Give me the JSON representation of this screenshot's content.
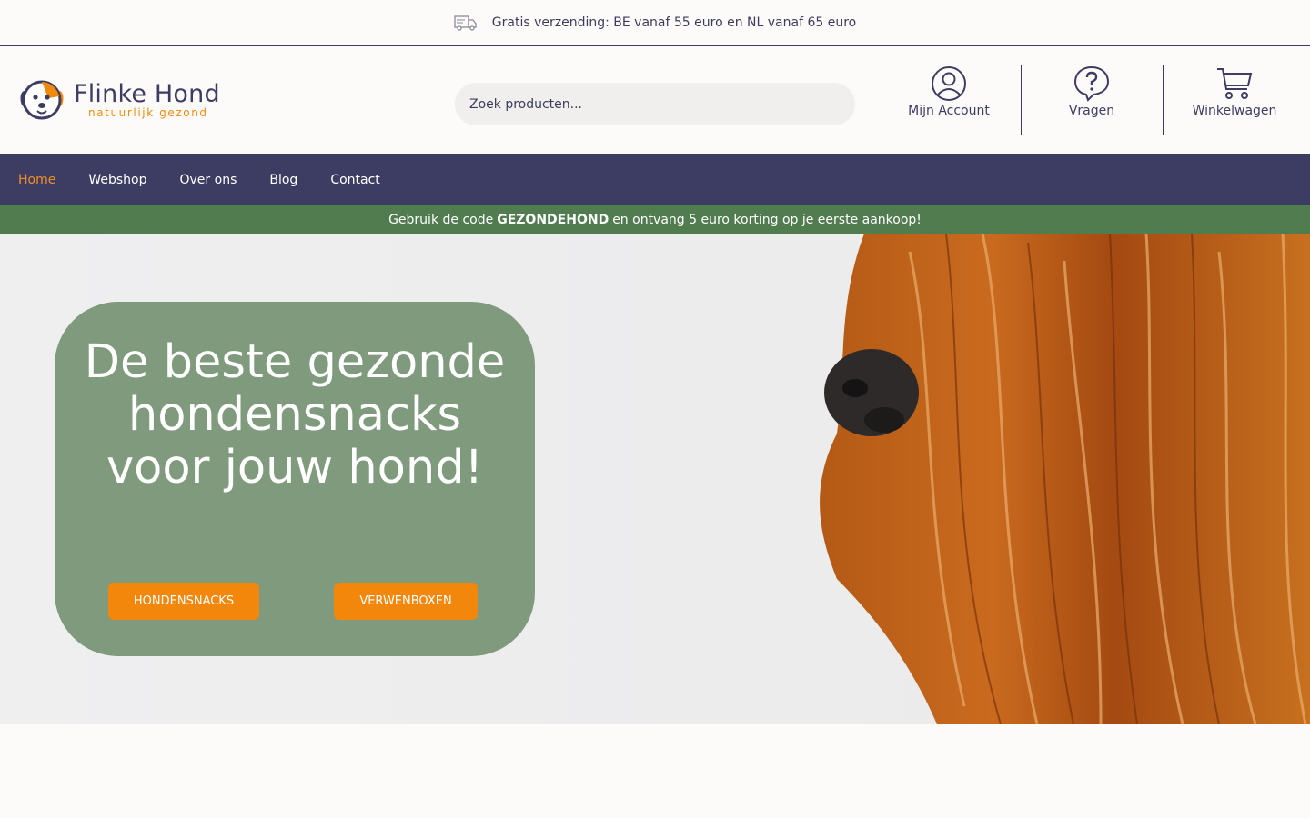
{
  "topbar": {
    "shipping_text": "Gratis verzending: BE vanaf 55 euro en NL vanaf 65 euro",
    "icon": "truck-icon"
  },
  "header": {
    "logo": {
      "name": "Flinke Hond",
      "tagline": "natuurlijk gezond"
    },
    "search": {
      "placeholder": "Zoek producten..."
    },
    "account_label": "Mijn Account",
    "questions_label": "Vragen",
    "cart_label": "Winkelwagen"
  },
  "nav": {
    "items": [
      {
        "label": "Home",
        "active": true
      },
      {
        "label": "Webshop"
      },
      {
        "label": "Over ons"
      },
      {
        "label": "Blog"
      },
      {
        "label": "Contact"
      }
    ]
  },
  "promo": {
    "before": "Gebruik de code",
    "code": "GEZONDEHOND",
    "after": "en ontvang 5 euro korting op je eerste aankoop!"
  },
  "hero": {
    "title": "De beste gezonde hondensnacks voor jouw hond!",
    "button1": "HONDENSNACKS",
    "button2": "VERWENBOXEN"
  },
  "colors": {
    "primary": "#3d3c63",
    "accent": "#f2870c",
    "promo_green": "#517c4f",
    "card_green": "#7f9a7d"
  }
}
